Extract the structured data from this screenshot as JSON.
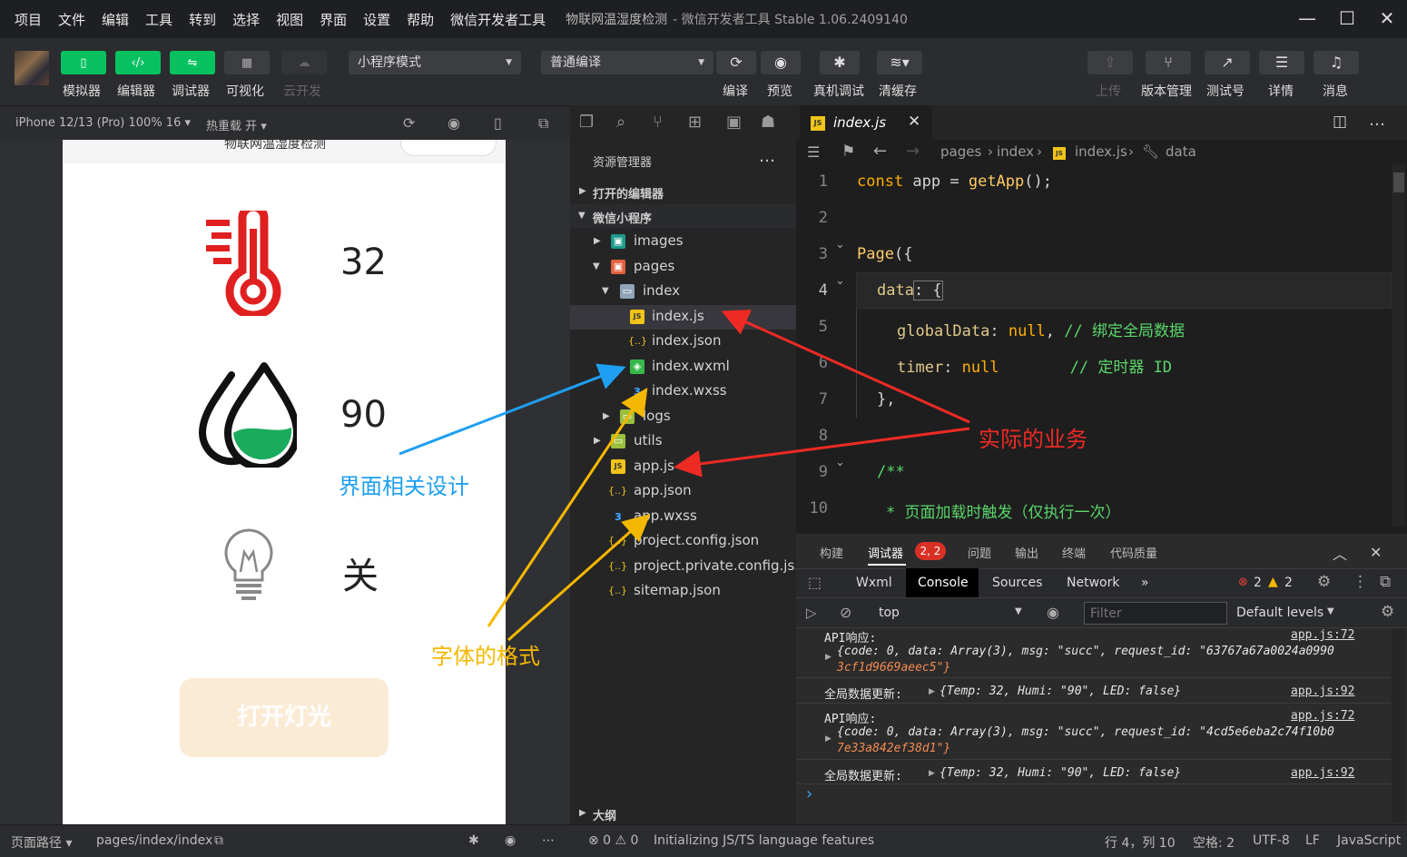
{
  "menubar": {
    "items": [
      "项目",
      "文件",
      "编辑",
      "工具",
      "转到",
      "选择",
      "视图",
      "界面",
      "设置",
      "帮助",
      "微信开发者工具"
    ],
    "title_project": "物联网温湿度检测",
    "title_app": "- 微信开发者工具 Stable 1.06.2409140"
  },
  "toolbar": {
    "simulator": "模拟器",
    "editor": "编辑器",
    "debugger": "调试器",
    "visual": "可视化",
    "cloud": "云开发",
    "mode_select": "小程序模式",
    "compile_select": "普通编译",
    "compile": "编译",
    "preview": "预览",
    "real_debug": "真机调试",
    "clear_cache": "清缓存",
    "upload": "上传",
    "version": "版本管理",
    "test_account": "测试号",
    "details": "详情",
    "messages": "消息"
  },
  "simulator": {
    "device": "iPhone 12/13 (Pro) 100% 16 ▾",
    "hot_reload": "热重载 开 ▾",
    "nav_title": "物联网温湿度检测",
    "temp_value": "32",
    "humi_value": "90",
    "led_value": "关",
    "light_button": "打开灯光"
  },
  "explorer": {
    "title": "资源管理器",
    "open_editors": "打开的编辑器",
    "project": "微信小程序",
    "outline": "大纲",
    "files": {
      "images": "images",
      "pages": "pages",
      "index_dir": "index",
      "index_js": "index.js",
      "index_json": "index.json",
      "index_wxml": "index.wxml",
      "index_wxss": "index.wxss",
      "logs": "logs",
      "utils": "utils",
      "app_js": "app.js",
      "app_json": "app.json",
      "app_wxss": "app.wxss",
      "project_config": "project.config.json",
      "project_private": "project.private.config.js...",
      "sitemap": "sitemap.json"
    }
  },
  "editor": {
    "tab": "index.js",
    "breadcrumb": {
      "pages": "pages",
      "index": "index",
      "file": "index.js",
      "symbol": "data"
    },
    "line_numbers": [
      "1",
      "2",
      "3",
      "4",
      "5",
      "6",
      "7",
      "8",
      "9",
      "10"
    ],
    "code": {
      "l1_kw": "const",
      "l1_var": " app = ",
      "l1_fn": "getApp",
      "l1_end": "();",
      "l3_fn": "Page",
      "l3_end": "({",
      "l4_prop": "data",
      "l4_end": ": {",
      "l5_prop": "globalData",
      "l5_mid": ": ",
      "l5_null": "null",
      "l5_comma": ", ",
      "l5_cm": "// 绑定全局数据",
      "l6_prop": "timer",
      "l6_mid": ": ",
      "l6_null": "null",
      "l6_cm": "// 定时器 ID",
      "l7": "},",
      "l9": "/**",
      "l10": "* 页面加载时触发（仅执行一次）"
    }
  },
  "devtools": {
    "tabs": [
      "构建",
      "调试器",
      "问题",
      "输出",
      "终端",
      "代码质量"
    ],
    "badge": "2, 2",
    "cdt_tabs": [
      "Wxml",
      "Console",
      "Sources",
      "Network"
    ],
    "err_count": "2",
    "warn_count": "2",
    "context": "top",
    "filter_placeholder": "Filter",
    "levels": "Default levels",
    "logs": {
      "api1_label": "API响应:",
      "api1_obj_a": "{code: 0, data: Array(3), msg: \"succ\", request_id: \"63767a67a0024a0990",
      "api1_obj_b": "3cf1d9669aeec5\"}",
      "src_72": "app.js:72",
      "update_label": "全局数据更新:",
      "update_obj": "{Temp: 32, Humi: \"90\", LED: false}",
      "src_92": "app.js:92",
      "api2_label": "API响应:",
      "api2_obj_a": "{code: 0, data: Array(3), msg: \"succ\", request_id: \"4cd5e6eba2c74f10b0",
      "api2_obj_b": "7e33a842ef38d1\"}",
      "prompt": "›"
    }
  },
  "statusbar": {
    "page_path_label": "页面路径 ▾",
    "page_path": "pages/index/index",
    "problems": "⊗ 0 ⚠ 0",
    "message": "Initializing JS/TS language features",
    "position": "行 4，列 10",
    "spaces": "空格: 2",
    "encoding": "UTF-8",
    "eol": "LF",
    "language": "JavaScript"
  },
  "annotations": {
    "blue": "界面相关设计",
    "orange": "字体的格式",
    "red": "实际的业务",
    "blue_color": "#1e9ff2",
    "orange_color": "#f5b800",
    "red_color": "#ee2a24"
  }
}
